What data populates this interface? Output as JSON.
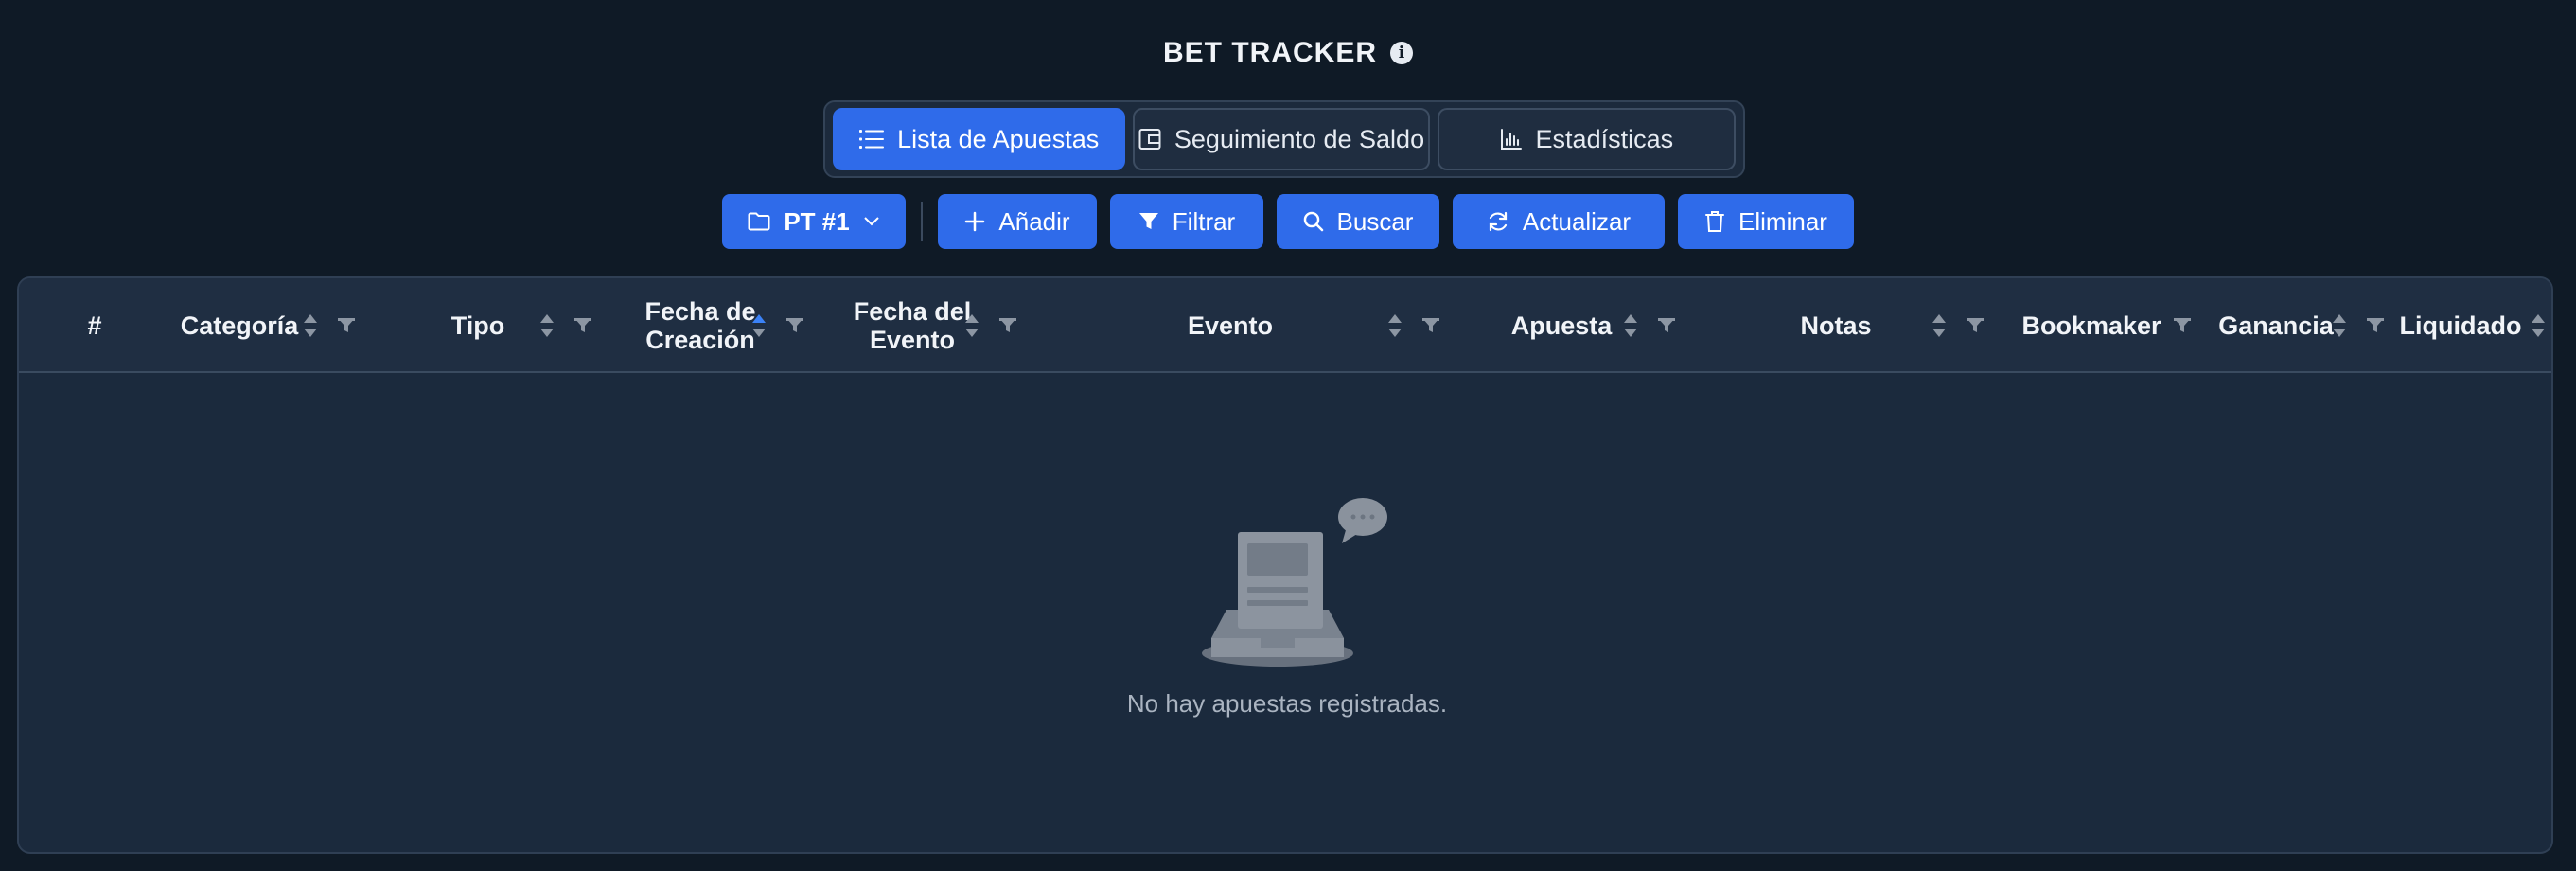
{
  "header": {
    "title": "BET TRACKER",
    "info_icon": "info-circle-icon"
  },
  "tabs": [
    {
      "label": "Lista de Apuestas",
      "icon": "list-icon",
      "active": true
    },
    {
      "label": "Seguimiento de Saldo",
      "icon": "wallet-icon",
      "active": false
    },
    {
      "label": "Estadísticas",
      "icon": "bar-chart-icon",
      "active": false
    }
  ],
  "toolbar": {
    "portfolio_label": "PT #1",
    "add_label": "Añadir",
    "filter_label": "Filtrar",
    "search_label": "Buscar",
    "refresh_label": "Actualizar",
    "delete_label": "Eliminar"
  },
  "table": {
    "columns": [
      {
        "key": "num",
        "label": "#"
      },
      {
        "key": "categoria",
        "label": "Categoría"
      },
      {
        "key": "tipo",
        "label": "Tipo"
      },
      {
        "key": "fecha_creacion",
        "label_line1": "Fecha de",
        "label_line2": "Creación",
        "sorted": "ascending"
      },
      {
        "key": "fecha_evento",
        "label_line1": "Fecha del",
        "label_line2": "Evento"
      },
      {
        "key": "evento",
        "label": "Evento"
      },
      {
        "key": "apuesta",
        "label": "Apuesta"
      },
      {
        "key": "notas",
        "label": "Notas"
      },
      {
        "key": "bookmaker",
        "label": "Bookmaker"
      },
      {
        "key": "ganancia",
        "label": "Ganancia"
      },
      {
        "key": "liquidado",
        "label": "Liquidado"
      }
    ],
    "empty_message": "No hay apuestas registradas."
  },
  "colors": {
    "background": "#0f1a26",
    "accent": "#2f6bea",
    "sort_active": "#3b82f6",
    "icon_muted": "#8c96a3"
  }
}
